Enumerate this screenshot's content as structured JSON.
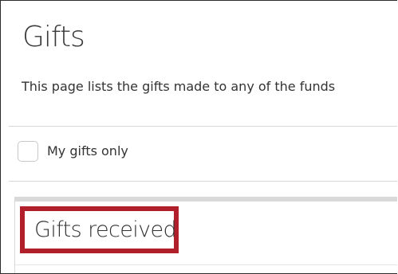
{
  "page": {
    "title": "Gifts",
    "description": "This page lists the gifts made to any of the funds"
  },
  "filter": {
    "my_gifts_label": "My gifts only",
    "my_gifts_checked": false
  },
  "section": {
    "title": "Gifts received",
    "highlight_color": "#b01f2a"
  }
}
